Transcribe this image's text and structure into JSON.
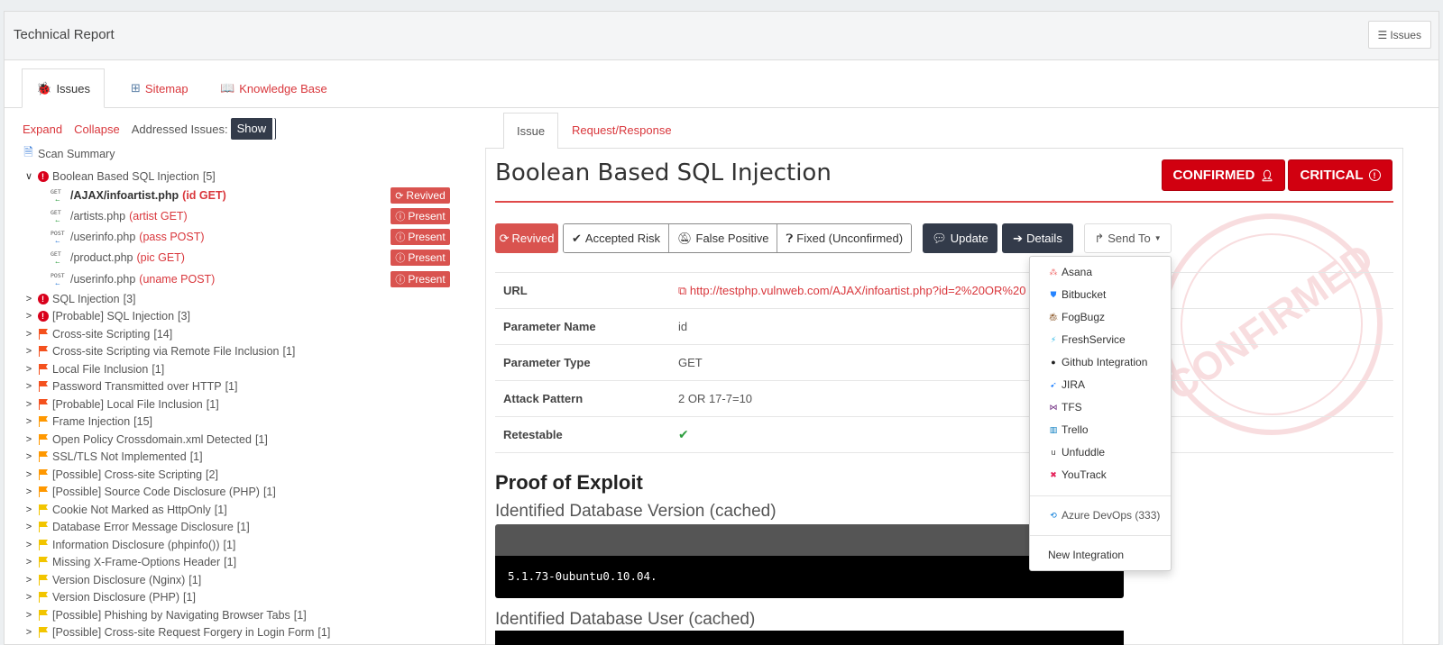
{
  "header": {
    "title": "Technical Report",
    "issues_button": "Issues"
  },
  "main_tabs": [
    {
      "label": "Issues"
    },
    {
      "label": "Sitemap"
    },
    {
      "label": "Knowledge Base"
    }
  ],
  "tools": {
    "expand": "Expand",
    "collapse": "Collapse",
    "addressed_label": "Addressed Issues:",
    "show_button": "Show"
  },
  "tree": {
    "scan_summary": "Scan Summary",
    "groups": [
      {
        "label": "Boolean Based SQL Injection",
        "count": "[5]",
        "expanded": true,
        "icon": "exclamation-circle-icon",
        "color": "#d9001b"
      },
      {
        "label": "SQL Injection",
        "count": "[3]",
        "icon": "exclamation-circle-icon",
        "color": "#d9001b"
      },
      {
        "label": "[Probable] SQL Injection",
        "count": "[3]",
        "icon": "exclamation-circle-icon",
        "color": "#d9001b"
      },
      {
        "label": "Cross-site Scripting",
        "count": "[14]",
        "icon": "flag-icon",
        "color": "#f4511e"
      },
      {
        "label": "Cross-site Scripting via Remote File Inclusion",
        "count": "[1]",
        "icon": "flag-icon",
        "color": "#f4511e"
      },
      {
        "label": "Local File Inclusion",
        "count": "[1]",
        "icon": "flag-icon",
        "color": "#f4511e"
      },
      {
        "label": "Password Transmitted over HTTP",
        "count": "[1]",
        "icon": "flag-icon",
        "color": "#f4511e"
      },
      {
        "label": "[Probable] Local File Inclusion",
        "count": "[1]",
        "icon": "flag-icon",
        "color": "#f4511e"
      },
      {
        "label": "Frame Injection",
        "count": "[15]",
        "icon": "flag-icon",
        "color": "#ff9800"
      },
      {
        "label": "Open Policy Crossdomain.xml Detected",
        "count": "[1]",
        "icon": "flag-icon",
        "color": "#ff9800"
      },
      {
        "label": "SSL/TLS Not Implemented",
        "count": "[1]",
        "icon": "flag-icon",
        "color": "#ff9800"
      },
      {
        "label": "[Possible] Cross-site Scripting",
        "count": "[2]",
        "icon": "flag-icon",
        "color": "#ff9800"
      },
      {
        "label": "[Possible] Source Code Disclosure (PHP)",
        "count": "[1]",
        "icon": "flag-icon",
        "color": "#ff9800"
      },
      {
        "label": "Cookie Not Marked as HttpOnly",
        "count": "[1]",
        "icon": "flag-icon",
        "color": "#f2c500"
      },
      {
        "label": "Database Error Message Disclosure",
        "count": "[1]",
        "icon": "flag-icon",
        "color": "#f2c500"
      },
      {
        "label": "Information Disclosure (phpinfo())",
        "count": "[1]",
        "icon": "flag-icon",
        "color": "#f2c500"
      },
      {
        "label": "Missing X-Frame-Options Header",
        "count": "[1]",
        "icon": "flag-icon",
        "color": "#f2c500"
      },
      {
        "label": "Version Disclosure (Nginx)",
        "count": "[1]",
        "icon": "flag-icon",
        "color": "#f2c500"
      },
      {
        "label": "Version Disclosure (PHP)",
        "count": "[1]",
        "icon": "flag-icon",
        "color": "#f2c500"
      },
      {
        "label": "[Possible] Phishing by Navigating Browser Tabs",
        "count": "[1]",
        "icon": "flag-icon",
        "color": "#f2c500"
      },
      {
        "label": "[Possible] Cross-site Request Forgery in Login Form",
        "count": "[1]",
        "icon": "flag-icon",
        "color": "#f2c500"
      }
    ],
    "children": [
      {
        "method": "GET",
        "path": "/AJAX/infoartist.php",
        "param": "(id GET)",
        "status": "Revived",
        "selected": true
      },
      {
        "method": "GET",
        "path": "/artists.php",
        "param": "(artist GET)",
        "status": "Present"
      },
      {
        "method": "POST",
        "path": "/userinfo.php",
        "param": "(pass POST)",
        "status": "Present"
      },
      {
        "method": "GET",
        "path": "/product.php",
        "param": "(pic GET)",
        "status": "Present"
      },
      {
        "method": "POST",
        "path": "/userinfo.php",
        "param": "(uname POST)",
        "status": "Present"
      }
    ]
  },
  "detail_tabs": [
    {
      "label": "Issue"
    },
    {
      "label": "Request/Response"
    }
  ],
  "issue": {
    "title": "Boolean Based SQL Injection",
    "confirmed_label": "CONFIRMED",
    "severity_label": "CRITICAL",
    "stamp_text": "CONFIRMED",
    "actions": {
      "revived": "Revived",
      "accepted_risk": "Accepted Risk",
      "false_positive": "False Positive",
      "fixed": "Fixed (Unconfirmed)",
      "update": "Update",
      "details": "Details",
      "send_to": "Send To"
    },
    "properties": [
      {
        "key": "URL",
        "value": "http://testphp.vulnweb.com/AJAX/infoartist.php?id=2%20OR%20"
      },
      {
        "key": "Parameter Name",
        "value": "id"
      },
      {
        "key": "Parameter Type",
        "value": "GET"
      },
      {
        "key": "Attack Pattern",
        "value": "2 OR 17-7=10"
      },
      {
        "key": "Retestable",
        "value": "✔"
      }
    ],
    "proof_title": "Proof of Exploit",
    "db_version_title": "Identified Database Version (cached)",
    "db_version_value": "5.1.73-0ubuntu0.10.04.",
    "db_user_title": "Identified Database User (cached)"
  },
  "send_to_menu": {
    "items": [
      {
        "label": "Asana",
        "icon": "asana-icon",
        "color": "#f06a6a"
      },
      {
        "label": "Bitbucket",
        "icon": "bitbucket-icon",
        "color": "#2684ff"
      },
      {
        "label": "FogBugz",
        "icon": "fogbugz-icon",
        "color": "#8d5a2b"
      },
      {
        "label": "FreshService",
        "icon": "freshservice-icon",
        "color": "#23b6e6"
      },
      {
        "label": "Github Integration",
        "icon": "github-icon",
        "color": "#222222"
      },
      {
        "label": "JIRA",
        "icon": "jira-icon",
        "color": "#2684ff"
      },
      {
        "label": "TFS",
        "icon": "tfs-icon",
        "color": "#68217a"
      },
      {
        "label": "Trello",
        "icon": "trello-icon",
        "color": "#0079bf"
      },
      {
        "label": "Unfuddle",
        "icon": "unfuddle-icon",
        "color": "#444444"
      },
      {
        "label": "YouTrack",
        "icon": "youtrack-icon",
        "color": "#e5225a"
      }
    ],
    "azure": "Azure DevOps (333)",
    "new_integration": "New Integration"
  }
}
